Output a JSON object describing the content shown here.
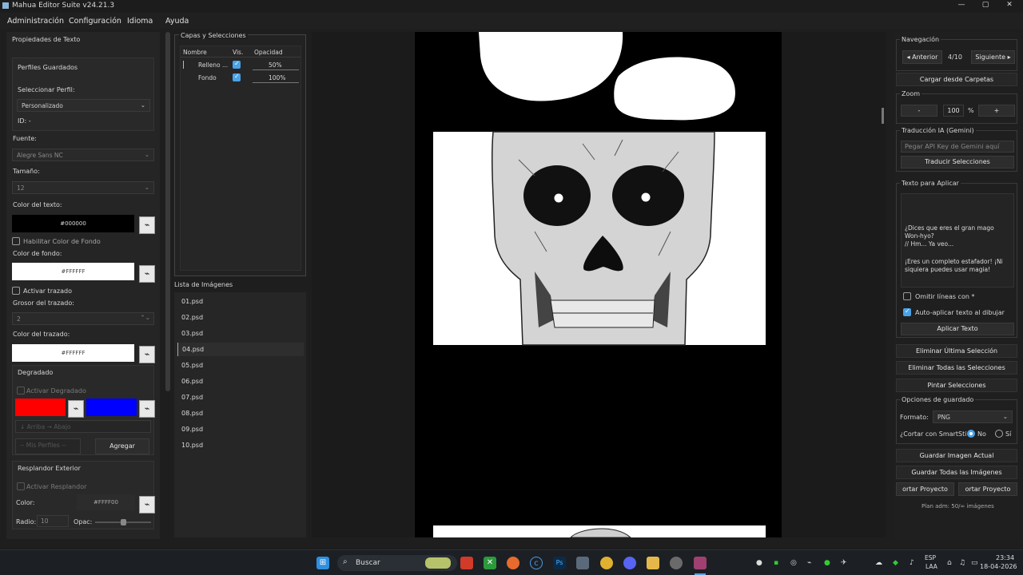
{
  "window": {
    "title": "Mahua Editor Suite v24.21.3",
    "controls": [
      "—",
      "▢",
      "✕"
    ]
  },
  "menu": [
    "Administración",
    "Configuración",
    "Idioma",
    "Ayuda"
  ],
  "left": {
    "section_title": "Propiedades de Texto",
    "profiles_title": "Perfiles Guardados",
    "select_profile_label": "Seleccionar Perfil:",
    "profile_value": "Personalizado",
    "id_label": "ID: -",
    "font_label": "Fuente:",
    "font_value": "Alegre Sans NC",
    "size_label": "Tamaño:",
    "size_value": "12",
    "text_color_label": "Color del texto:",
    "text_color_value": "#000000",
    "enable_bg_label": "Habilitar Color de Fondo",
    "bg_color_label": "Color de fondo:",
    "bg_color_value": "#FFFFFF",
    "stroke_enable_label": "Activar trazado",
    "stroke_width_label": "Grosor del trazado:",
    "stroke_width_value": "2",
    "stroke_color_label": "Color del trazado:",
    "stroke_color_value": "#FFFFFF",
    "gradient_title": "Degradado",
    "gradient_enable_label": "Activar Degradado",
    "gradient_direction": "↓ Arriba → Abajo",
    "my_profiles": "-- Mis Perfiles --",
    "add_button": "Agregar",
    "glow_title": "Resplandor Exterior",
    "glow_enable_label": "Activar Resplandor",
    "glow_color_label": "Color:",
    "glow_color_value": "#FFFF00",
    "radius_label": "Radio:",
    "radius_value": "10",
    "opacity_label": "Opac:"
  },
  "layers": {
    "title": "Capas y Selecciones",
    "columns": [
      "Nombre",
      "Vis.",
      "Opacidad"
    ],
    "rows": [
      {
        "name": "Relleno ...",
        "visible": true,
        "opacity": "50%"
      },
      {
        "name": "Fondo",
        "visible": true,
        "opacity": "100%"
      }
    ]
  },
  "images": {
    "title": "Lista de Imágenes",
    "items": [
      "01.psd",
      "02.psd",
      "03.psd",
      "04.psd",
      "05.psd",
      "06.psd",
      "07.psd",
      "08.psd",
      "09.psd",
      "10.psd"
    ],
    "selected_index": 3
  },
  "right": {
    "nav_title": "Navegación",
    "prev": "◂ Anterior",
    "page": "4/10",
    "next": "Siguiente ▸",
    "load_folder": "Cargar desde Carpetas",
    "zoom_title": "Zoom",
    "zoom_minus": "-",
    "zoom_value": "100",
    "zoom_pct": "%",
    "zoom_plus": "+",
    "ai_title": "Traducción IA (Gemini)",
    "api_placeholder": "Pegar API Key de Gemini aquí",
    "translate_btn": "Traducir Selecciones",
    "text_apply_title": "Texto para Aplicar",
    "text_lines": [
      "¿Dices que eres el gran mago Won-hyo?",
      "// Hm... Ya veo...",
      "",
      "¡Eres un completo estafador! ¡Ni siquiera puedes usar magia!"
    ],
    "omit_lines": "Omitir líneas con *",
    "auto_apply": "Auto-aplicar texto al dibujar",
    "apply_btn": "Aplicar Texto",
    "delete_last": "Eliminar Última Selección",
    "delete_all": "Eliminar Todas las Selecciones",
    "paint": "Pintar Selecciones",
    "save_opts_title": "Opciones de guardado",
    "format_label": "Formato:",
    "format_value": "PNG",
    "cut_label": "¿Cortar con SmartSti",
    "no": "No",
    "yes": "Sí",
    "save_current": "Guardar Imagen Actual",
    "save_all": "Guardar Todas las Imágenes",
    "export1": "ortar Proyecto (JSC",
    "export2": "ortar Proyecto (JSC",
    "plan": "Plan adm: 50/∞ imágenes"
  },
  "taskbar": {
    "search": "Buscar",
    "lang1": "ESP",
    "lang2": "LAA",
    "time": "23:34",
    "date": "18-04-2026"
  },
  "colors": {
    "accent": "#4aa3e8",
    "red": "#ff0000",
    "blue": "#0000ff"
  }
}
